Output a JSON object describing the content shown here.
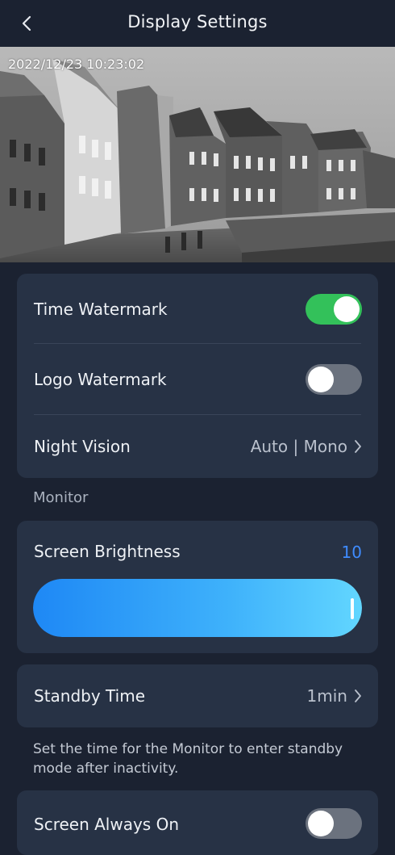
{
  "header": {
    "title": "Display Settings",
    "back_icon": "chevron-left-icon"
  },
  "preview": {
    "timestamp": "2022/12/23 10:23:02"
  },
  "watermark_card": {
    "time_watermark": {
      "label": "Time Watermark",
      "enabled": true
    },
    "logo_watermark": {
      "label": "Logo Watermark",
      "enabled": false
    },
    "night_vision": {
      "label": "Night Vision",
      "value": "Auto | Mono"
    }
  },
  "monitor_section": {
    "label": "Monitor"
  },
  "brightness": {
    "label": "Screen Brightness",
    "value": "10",
    "level": 1.0
  },
  "standby": {
    "label": "Standby Time",
    "value": "1min",
    "help": "Set the time for the Monitor to enter standby mode after inactivity."
  },
  "always_on": {
    "label": "Screen Always On",
    "enabled": false
  },
  "colors": {
    "background": "#1b2231",
    "card": "#273245",
    "toggle_on": "#33c15a",
    "toggle_off": "#6b727e",
    "accent": "#3f8cff"
  }
}
